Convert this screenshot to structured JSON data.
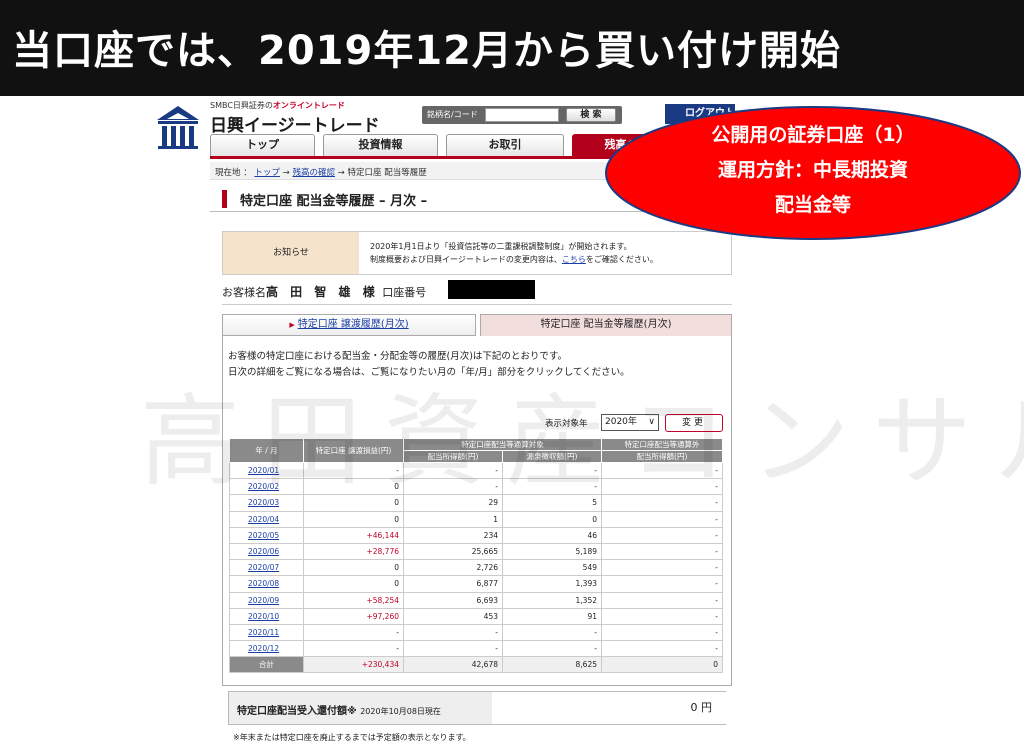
{
  "banner": {
    "title": "当口座では、2019年12月から買い付け開始"
  },
  "watermark": "高田資産コンサル",
  "logo": {
    "sub_prefix": "SMBC日興証券の",
    "sub_highlight": "オンライントレード",
    "name": "日興イージートレード"
  },
  "search": {
    "label": "銘柄名/コード",
    "button": "検 索",
    "value": ""
  },
  "logout_label": "ログアウト",
  "nav": {
    "tabs": [
      "トップ",
      "投資情報",
      "お取引",
      "残高の確認"
    ]
  },
  "breadcrumb": {
    "prefix": "現在地 ：",
    "home": "トップ",
    "sep1": "→",
    "balance": "残高の確認",
    "sep2": "→",
    "current": "特定口座 配当等履歴"
  },
  "page_title": "特定口座 配当金等履歴 – 月次 –",
  "notice": {
    "label": "お知らせ",
    "line1": "2020年1月1日より「投資信託等の二重課税調整制度」が開始されます。",
    "line2_pre": "制度概要および日興イージートレードの変更内容は、",
    "line2_link": "こちら",
    "line2_post": "をご確認ください。"
  },
  "customer": {
    "prefix": "お客様名",
    "name": "高 田 智 雄 様",
    "account_label": "口座番号"
  },
  "sub_tabs": {
    "transfer": "特定口座 譲渡履歴(月次)",
    "dividend": "特定口座 配当金等履歴(月次)"
  },
  "description": {
    "line1": "お客様の特定口座における配当金・分配金等の履歴(月次)は下記のとおりです。",
    "line2": "日次の詳細をご覧になる場合は、ご覧になりたい月の「年/月」部分をクリックしてください。"
  },
  "filter": {
    "label": "表示対象年",
    "selected": "2020年",
    "button": "変更"
  },
  "table": {
    "headers": {
      "ym": "年 / 月",
      "transfer": "特定口座 譲渡損益(円)",
      "group_in": "特定口座配当等通算対象",
      "div_income": "配当所得額(円)",
      "withholding": "源泉徴収額(円)",
      "group_out": "特定口座配当等通算外",
      "div_income_out": "配当所得額(円)"
    },
    "rows": [
      {
        "ym": "2020/01",
        "transfer": "-",
        "div": "-",
        "tax": "-",
        "out": "-"
      },
      {
        "ym": "2020/02",
        "transfer": "0",
        "div": "-",
        "tax": "-",
        "out": "-"
      },
      {
        "ym": "2020/03",
        "transfer": "0",
        "div": "29",
        "tax": "5",
        "out": "-"
      },
      {
        "ym": "2020/04",
        "transfer": "0",
        "div": "1",
        "tax": "0",
        "out": "-"
      },
      {
        "ym": "2020/05",
        "transfer": "+46,144",
        "div": "234",
        "tax": "46",
        "out": "-"
      },
      {
        "ym": "2020/06",
        "transfer": "+28,776",
        "div": "25,665",
        "tax": "5,189",
        "out": "-"
      },
      {
        "ym": "2020/07",
        "transfer": "0",
        "div": "2,726",
        "tax": "549",
        "out": "-"
      },
      {
        "ym": "2020/08",
        "transfer": "0",
        "div": "6,877",
        "tax": "1,393",
        "out": "-"
      },
      {
        "ym": "2020/09",
        "transfer": "+58,254",
        "div": "6,693",
        "tax": "1,352",
        "out": "-"
      },
      {
        "ym": "2020/10",
        "transfer": "+97,260",
        "div": "453",
        "tax": "91",
        "out": "-"
      },
      {
        "ym": "2020/11",
        "transfer": "-",
        "div": "-",
        "tax": "-",
        "out": "-"
      },
      {
        "ym": "2020/12",
        "transfer": "-",
        "div": "-",
        "tax": "-",
        "out": "-"
      }
    ],
    "total": {
      "label": "合計",
      "transfer": "+230,434",
      "div": "42,678",
      "tax": "8,625",
      "out": "0"
    }
  },
  "refund": {
    "label": "特定口座配当受入還付額※",
    "date": "2020年10月08日現在",
    "value": "0 円"
  },
  "footnote": "※年末または特定口座を廃止するまでは予定額の表示となります。",
  "overlay": {
    "line1": "公開用の証券口座（1）",
    "line2": "運用方針：中長期投資",
    "line3": "配当金等"
  },
  "colors": {
    "brand_red": "#b3001b",
    "navy": "#1b3a84",
    "link": "#1a3ea6",
    "overlay_red": "#ff0000"
  }
}
